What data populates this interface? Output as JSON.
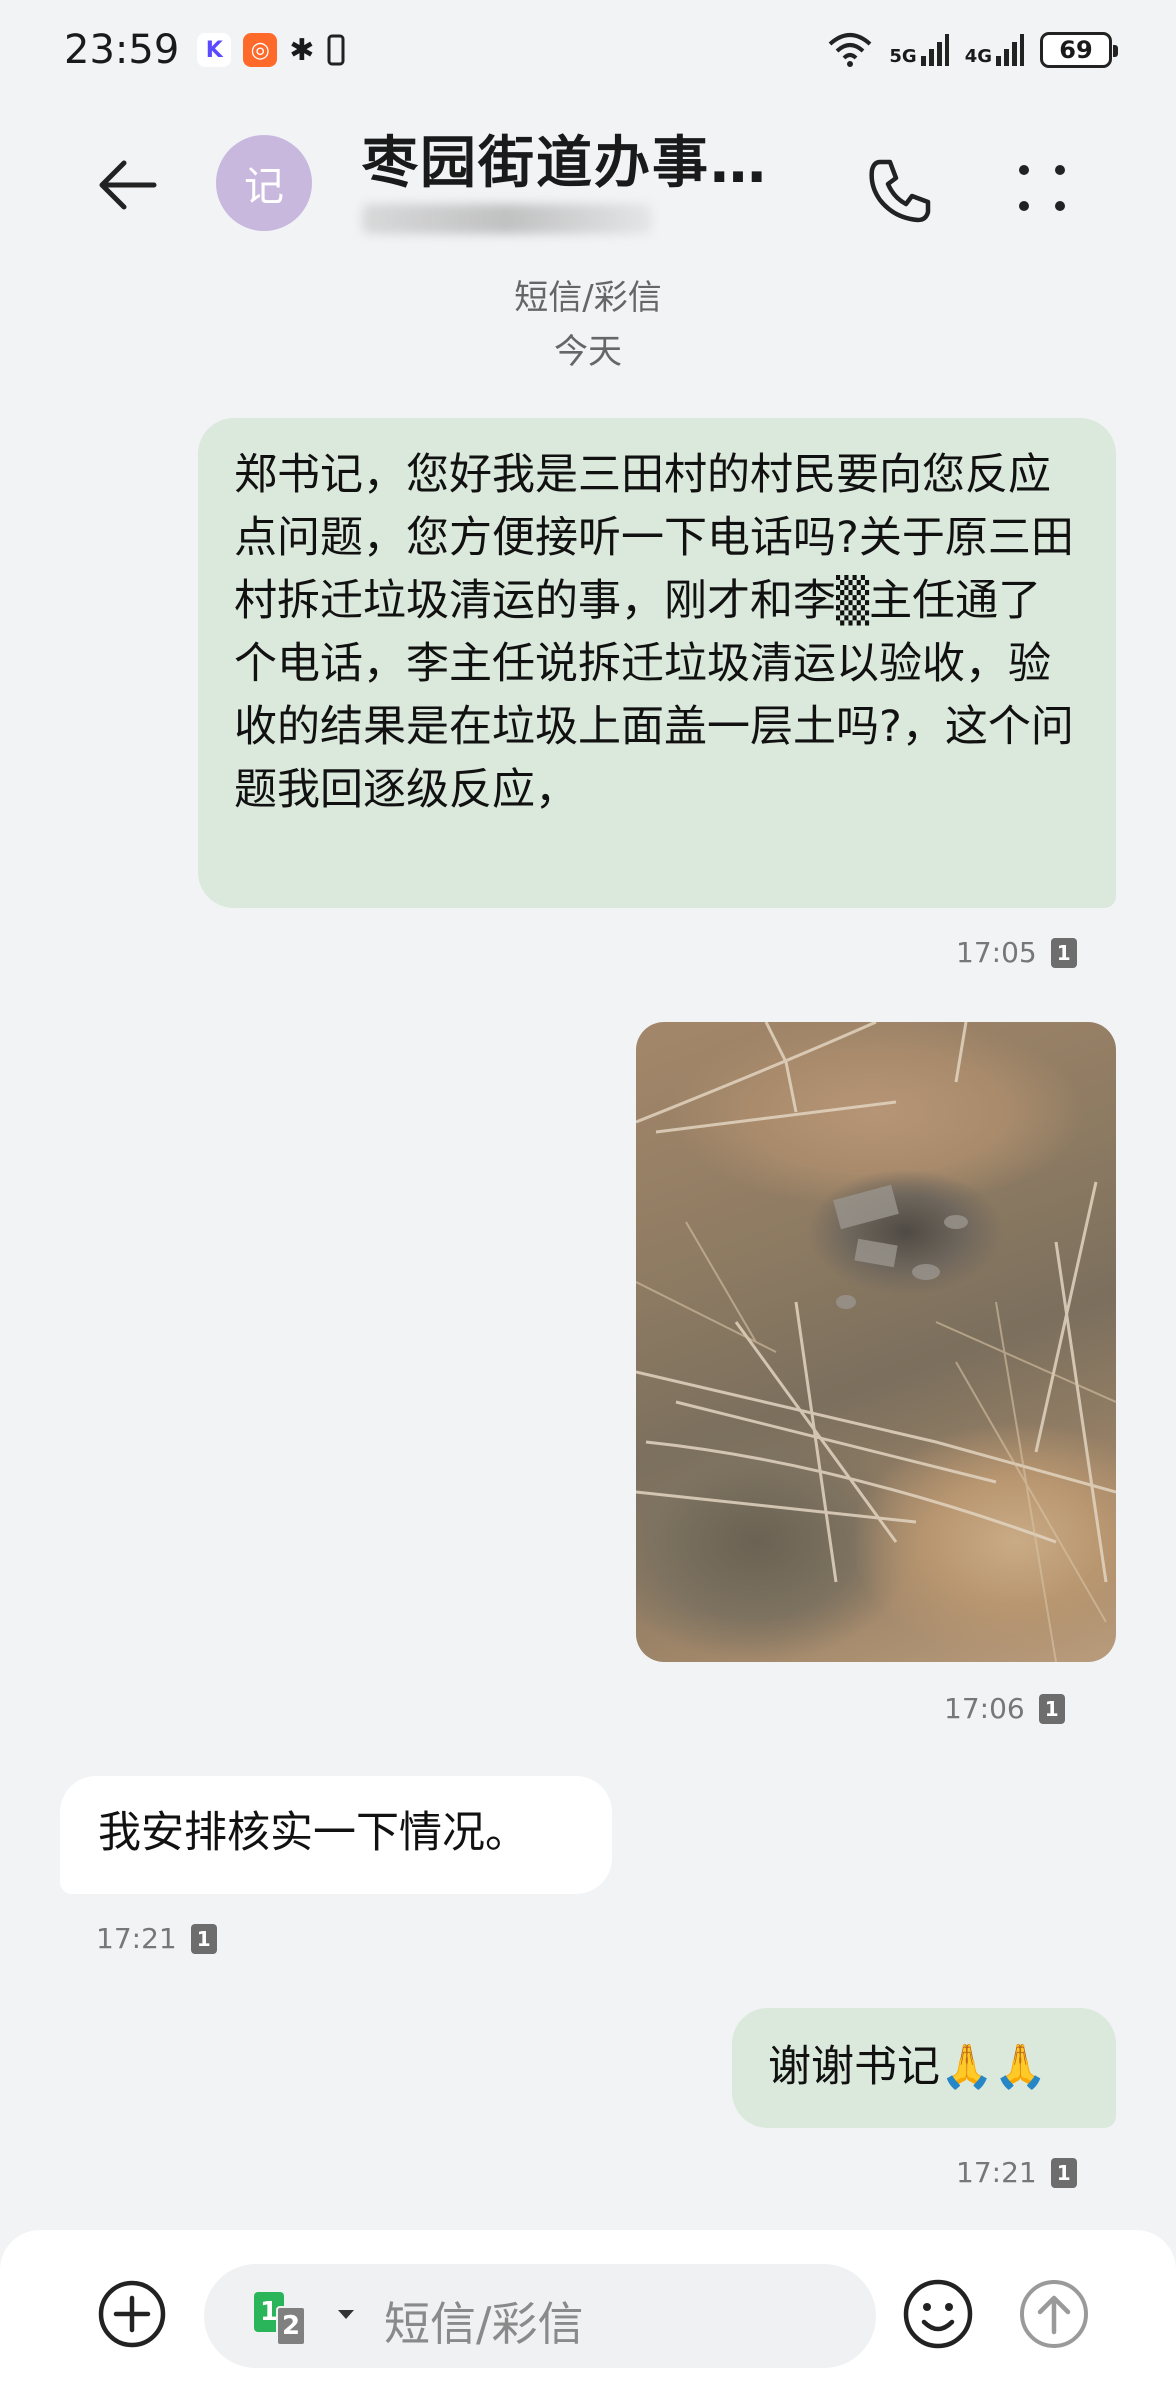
{
  "status_bar": {
    "time": "23:59",
    "network_5g": "5G",
    "network_4g": "4G",
    "battery": "69"
  },
  "header": {
    "avatar_char": "记",
    "contact_name": "枣园街道办事…",
    "contact_number_redacted": "",
    "message_type": "短信/彩信",
    "date": "今天"
  },
  "messages": [
    {
      "direction": "outgoing",
      "text": "郑书记，您好我是三田村的村民要向您反应点问题，您方便接听一下电话吗?关于原三田村拆迁垃圾清运的事，刚才和李▒主任通了个电话，李主任说拆迁垃圾清运以验收，验收的结果是在垃圾上面盖一层土吗?，这个问题我回逐级反应，",
      "time": "17:05",
      "sim": "1"
    },
    {
      "direction": "outgoing",
      "type": "image",
      "time": "17:06",
      "sim": "1"
    },
    {
      "direction": "incoming",
      "text": "我安排核实一下情况。",
      "time": "17:21",
      "sim": "1"
    },
    {
      "direction": "outgoing",
      "text": "谢谢书记🙏🙏",
      "time": "17:21",
      "sim": "1"
    }
  ],
  "compose": {
    "sim_primary": "1",
    "sim_secondary": "2",
    "placeholder": "短信/彩信"
  },
  "colors": {
    "background": "#f1f3f5",
    "outgoing_bubble": "#dbe8dc",
    "incoming_bubble": "#ffffff",
    "avatar": "#c9b8de",
    "sim_green": "#2ab55a"
  }
}
